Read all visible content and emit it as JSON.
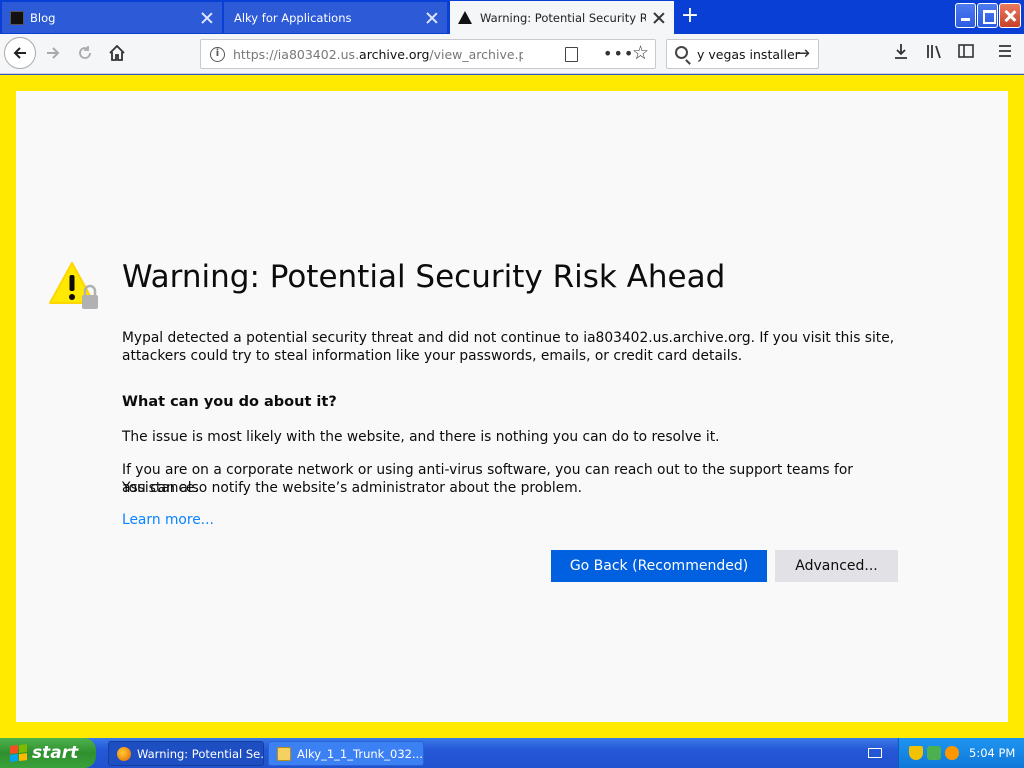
{
  "browser": {
    "tabs": [
      {
        "title": "Blog",
        "active": false
      },
      {
        "title": "Alky for Applications",
        "active": false
      },
      {
        "title": "Warning: Potential Security Risk Ah",
        "active": true
      }
    ],
    "url_prefix": "https://ia803402.us.",
    "url_domain": "archive.org",
    "url_suffix": "/view_archive.php?a",
    "search_value": "y vegas installer"
  },
  "page": {
    "heading": "Warning: Potential Security Risk Ahead",
    "intro_line1": "Mypal detected a potential security threat and did not continue to ia803402.us.archive.org. If you visit this site,",
    "intro_line2": "attackers could try to steal information like your passwords, emails, or credit card details.",
    "subheading": "What can you do about it?",
    "issue_text": "The issue is most likely with the website, and there is nothing you can do to resolve it.",
    "corporate_line1": "If you are on a corporate network or using anti-virus software, you can reach out to the support teams for assistance.",
    "corporate_line2": "You can also notify the website’s administrator about the problem.",
    "learn_more": "Learn more...",
    "go_back_label": "Go Back (Recommended)",
    "advanced_label": "Advanced..."
  },
  "taskbar": {
    "start_label": "start",
    "items": [
      {
        "label": "Warning: Potential Se..."
      },
      {
        "label": "Alky_1_1_Trunk_032..."
      }
    ],
    "clock": "5:04 PM"
  },
  "colors": {
    "frame_yellow": "#ffea00",
    "primary_blue": "#0060df",
    "link_blue": "#0a84ff",
    "xp_taskbar": "#2457d6",
    "xp_start_green": "#3aa23a"
  }
}
